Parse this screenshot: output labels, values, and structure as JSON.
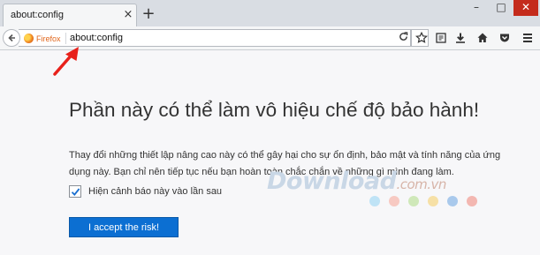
{
  "tab": {
    "title": "about:config",
    "close_icon": "×"
  },
  "new_tab_icon": "+",
  "window_controls": {
    "minimize": "–",
    "maximize": "□",
    "close": "✕"
  },
  "urlbar": {
    "identity_label": "Firefox",
    "url": "about:config"
  },
  "content": {
    "heading": "Phần này có thể làm vô hiệu chế độ bảo hành!",
    "warning": "Thay đổi những thiết lập nâng cao này có thể gây hại cho sự ổn định, bảo mật và tính năng của ứng dụng này. Bạn chỉ nên tiếp tục nếu bạn hoàn toàn chắc chắn về những gì mình đang làm.",
    "checkbox_label": "Hiện cảnh báo này vào lần sau",
    "checkbox_checked": true,
    "accept_button": "I accept the risk!"
  },
  "watermark": {
    "text": "Download",
    "domain": ".com.vn"
  },
  "colors": {
    "accent": "#0c6fd2",
    "arrow": "#e8211b",
    "dots": [
      "#bfe3f6",
      "#f7c9c2",
      "#cfe8b9",
      "#f6e0a6",
      "#a9c9ec",
      "#f3b7b1"
    ]
  }
}
